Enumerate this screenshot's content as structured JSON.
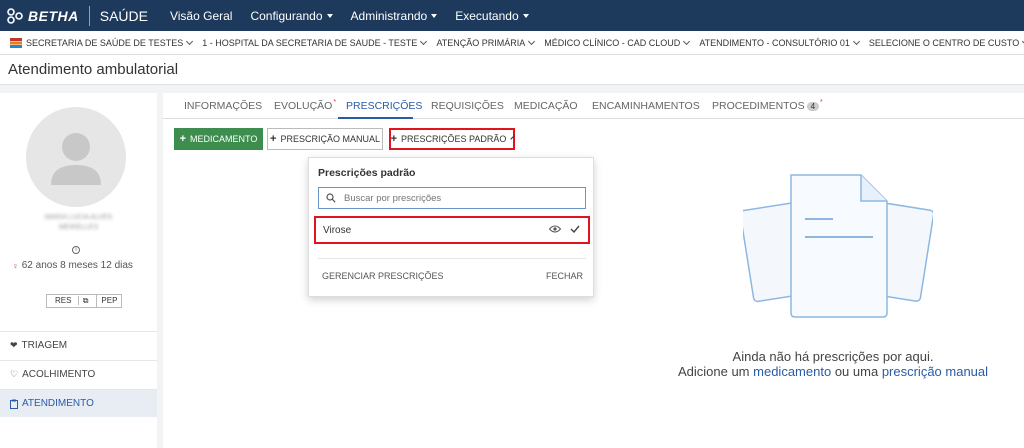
{
  "topbar": {
    "brand": "BETHA",
    "product": "SAÚDE",
    "nav": [
      {
        "label": "Visão Geral",
        "dropdown": false
      },
      {
        "label": "Configurando",
        "dropdown": true
      },
      {
        "label": "Administrando",
        "dropdown": true
      },
      {
        "label": "Executando",
        "dropdown": true
      }
    ],
    "colors": {
      "background": "#1d3a5c"
    }
  },
  "context": {
    "entity": "SECRETARIA DE SAÚDE DE TESTES",
    "unit": "1 - HOSPITAL DA SECRETARIA DE SAUDE - TESTE",
    "care_level": "ATENÇÃO PRIMÁRIA",
    "professional": "MÉDICO CLÍNICO - CAD CLOUD",
    "service": "ATENDIMENTO - CONSULTÓRIO 01",
    "cost_center": "SELECIONE O CENTRO DE CUSTO"
  },
  "page": {
    "title": "Atendimento ambulatorial"
  },
  "patient": {
    "name_line1": "MARIA LUCIA ALVES",
    "name_line2": "MEIRELLES",
    "age": "62 anos 8 meses 12 dias",
    "res_label": "RES",
    "pep_label": "PEP"
  },
  "sidebar": {
    "items": [
      {
        "label": "TRIAGEM",
        "icon": "heart-pulse-icon",
        "active": false
      },
      {
        "label": "ACOLHIMENTO",
        "icon": "heart-outline-icon",
        "active": false
      },
      {
        "label": "ATENDIMENTO",
        "icon": "clipboard-icon",
        "active": true
      }
    ]
  },
  "tabs": [
    {
      "label": "INFORMAÇÕES",
      "active": false,
      "required": false
    },
    {
      "label": "EVOLUÇÃO",
      "active": false,
      "required": true
    },
    {
      "label": "PRESCRIÇÕES",
      "active": true,
      "required": false
    },
    {
      "label": "REQUISIÇÕES",
      "active": false,
      "required": false
    },
    {
      "label": "MEDICAÇÃO",
      "active": false,
      "required": false
    },
    {
      "label": "ENCAMINHAMENTOS",
      "active": false,
      "required": false
    },
    {
      "label": "PROCEDIMENTOS",
      "active": false,
      "required": true,
      "badge": "4"
    }
  ],
  "toolbar": {
    "add_medication": "MEDICAMENTO",
    "manual_prescription": "PRESCRIÇÃO MANUAL",
    "standard_prescriptions": "PRESCRIÇÕES PADRÃO"
  },
  "popup": {
    "title": "Prescrições padrão",
    "search_placeholder": "Buscar por prescrições",
    "options": [
      {
        "label": "Virose",
        "selected": true
      }
    ],
    "manage": "GERENCIAR PRESCRIÇÕES",
    "close": "FECHAR"
  },
  "empty_state": {
    "line1": "Ainda não há prescrições por aqui.",
    "prefix": "Adicione um",
    "link1": "medicamento",
    "middle": "ou uma",
    "link2": "prescrição manual"
  },
  "colors": {
    "accent": "#2a5ba8",
    "success": "#3d8d4f",
    "highlight_border": "#e0141e"
  }
}
